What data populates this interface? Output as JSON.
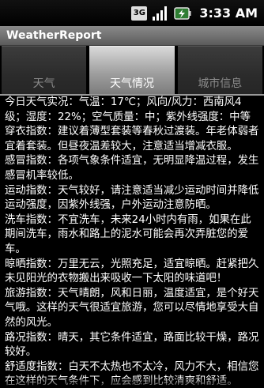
{
  "status_bar": {
    "network": "3G",
    "time": "3:33 AM"
  },
  "app": {
    "title": "WeatherReport"
  },
  "tabs": [
    {
      "label": "天气",
      "selected": false
    },
    {
      "label": "天气情况",
      "selected": true
    },
    {
      "label": "城市信息",
      "selected": false
    }
  ],
  "content": {
    "paragraphs": [
      "今日天气实况：气温：17℃；风向/风力：西南风4级；湿度：22%；空气质量：中；紫外线强度：中等",
      "穿衣指数：建议着薄型套装等春秋过渡装。年老体弱者宜着套装。但昼夜温差较大，注意适当增减衣服。",
      "感冒指数：各项气象条件适宜，无明显降温过程，发生感冒机率较低。",
      "运动指数：天气较好，请注意适当减少运动时间并降低运动强度，因紫外线强，户外运动注意防晒。",
      "洗车指数：不宜洗车，未来24小时内有雨，如果在此期间洗车，雨水和路上的泥水可能会再次弄脏您的爱车。",
      "晾晒指数：万里无云，光照充足，适宜晾晒。赶紧把久未见阳光的衣物搬出来吸收一下太阳的味道吧！",
      "旅游指数：天气晴朗，风和日丽，温度适宜，是个好天气哦。这样的天气很适宜旅游，您可以尽情地享受大自然的风光。",
      "路况指数：晴天，其它条件适宜，路面比较干燥，路况较好。",
      "舒适度指数：白天不太热也不太冷，风力不大，相信您在这样的天气条件下，应会感到比较清爽和舒适。"
    ]
  },
  "colors": {
    "background": "#000000",
    "text": "#ffffff",
    "tab_selected": "#9f9f9f",
    "tab_unselected": "#2b2b2b",
    "titlebar": "#6e6e6e"
  }
}
